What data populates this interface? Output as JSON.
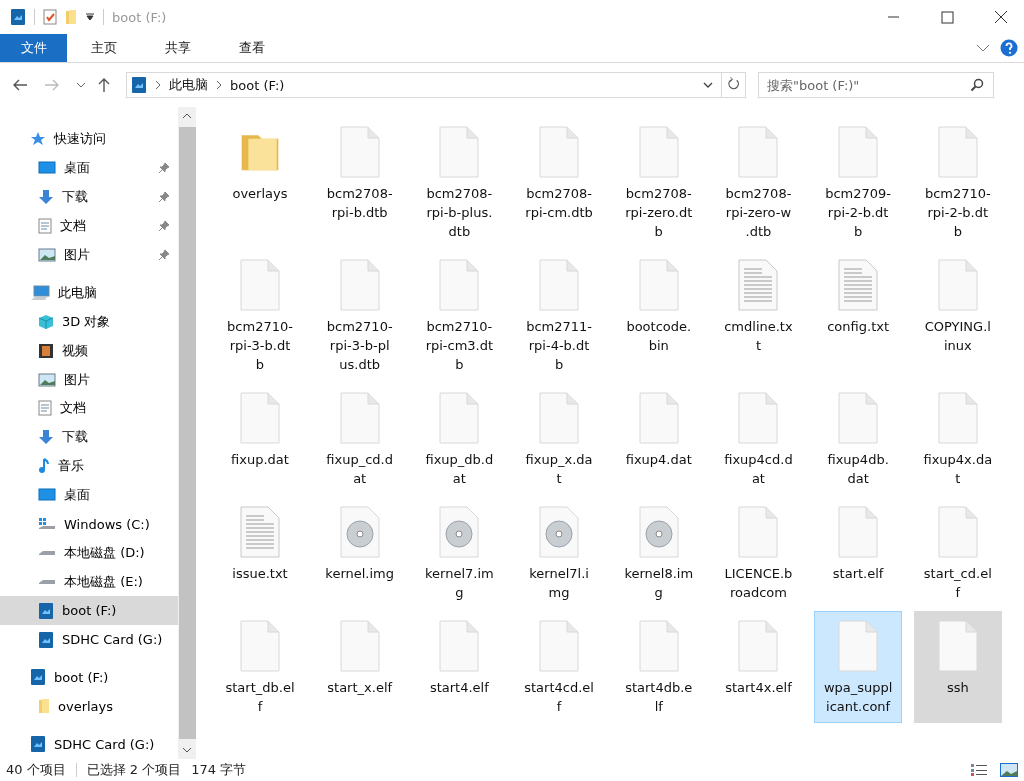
{
  "window": {
    "title": "boot (F:)"
  },
  "ribbon_tabs": [
    {
      "label": "文件",
      "selected": true
    },
    {
      "label": "主页",
      "selected": false
    },
    {
      "label": "共享",
      "selected": false
    },
    {
      "label": "查看",
      "selected": false
    }
  ],
  "address": {
    "crumbs": [
      "此电脑",
      "boot (F:)"
    ]
  },
  "search": {
    "placeholder": "搜索\"boot (F:)\""
  },
  "sidebar": {
    "items": [
      {
        "label": "快速访问",
        "kind": "star",
        "pinned": false,
        "selected": false,
        "children": [
          {
            "label": "桌面",
            "kind": "desktop",
            "pinned": true,
            "selected": false
          },
          {
            "label": "下载",
            "kind": "download",
            "pinned": true,
            "selected": false
          },
          {
            "label": "文档",
            "kind": "document",
            "pinned": true,
            "selected": false
          },
          {
            "label": "图片",
            "kind": "picture",
            "pinned": true,
            "selected": false
          }
        ]
      },
      {
        "label": "此电脑",
        "kind": "pc",
        "pinned": false,
        "selected": false,
        "children": [
          {
            "label": "3D 对象",
            "kind": "cube",
            "pinned": false,
            "selected": false
          },
          {
            "label": "视频",
            "kind": "video",
            "pinned": false,
            "selected": false
          },
          {
            "label": "图片",
            "kind": "picture",
            "pinned": false,
            "selected": false
          },
          {
            "label": "文档",
            "kind": "document",
            "pinned": false,
            "selected": false
          },
          {
            "label": "下载",
            "kind": "download",
            "pinned": false,
            "selected": false
          },
          {
            "label": "音乐",
            "kind": "music",
            "pinned": false,
            "selected": false
          },
          {
            "label": "桌面",
            "kind": "desktop",
            "pinned": false,
            "selected": false
          },
          {
            "label": "Windows (C:)",
            "kind": "windrive",
            "pinned": false,
            "selected": false
          },
          {
            "label": "本地磁盘 (D:)",
            "kind": "drive",
            "pinned": false,
            "selected": false
          },
          {
            "label": "本地磁盘 (E:)",
            "kind": "drive",
            "pinned": false,
            "selected": false
          },
          {
            "label": "boot (F:)",
            "kind": "sd",
            "pinned": false,
            "selected": true
          },
          {
            "label": "SDHC Card (G:)",
            "kind": "sd",
            "pinned": false,
            "selected": false
          }
        ]
      },
      {
        "label": "boot (F:)",
        "kind": "sd",
        "pinned": false,
        "selected": false,
        "children": [
          {
            "label": "overlays",
            "kind": "folder",
            "pinned": false,
            "selected": false
          }
        ]
      },
      {
        "label": "SDHC Card (G:)",
        "kind": "sd",
        "pinned": false,
        "selected": false
      }
    ]
  },
  "files": [
    {
      "lines": [
        "overlays"
      ],
      "kind": "folder",
      "selected": false,
      "hovered": false
    },
    {
      "lines": [
        "bcm2708-",
        "rpi-b.dtb"
      ],
      "kind": "blank",
      "selected": false,
      "hovered": false
    },
    {
      "lines": [
        "bcm2708-",
        "rpi-b-plus.",
        "dtb"
      ],
      "kind": "blank",
      "selected": false,
      "hovered": false
    },
    {
      "lines": [
        "bcm2708-",
        "rpi-cm.dtb"
      ],
      "kind": "blank",
      "selected": false,
      "hovered": false
    },
    {
      "lines": [
        "bcm2708-",
        "rpi-zero.dt",
        "b"
      ],
      "kind": "blank",
      "selected": false,
      "hovered": false
    },
    {
      "lines": [
        "bcm2708-",
        "rpi-zero-w",
        ".dtb"
      ],
      "kind": "blank",
      "selected": false,
      "hovered": false
    },
    {
      "lines": [
        "bcm2709-",
        "rpi-2-b.dt",
        "b"
      ],
      "kind": "blank",
      "selected": false,
      "hovered": false
    },
    {
      "lines": [
        "bcm2710-",
        "rpi-2-b.dt",
        "b"
      ],
      "kind": "blank",
      "selected": false,
      "hovered": false
    },
    {
      "lines": [
        "bcm2710-",
        "rpi-3-b.dt",
        "b"
      ],
      "kind": "blank",
      "selected": false,
      "hovered": false
    },
    {
      "lines": [
        "bcm2710-",
        "rpi-3-b-pl",
        "us.dtb"
      ],
      "kind": "blank",
      "selected": false,
      "hovered": false
    },
    {
      "lines": [
        "bcm2710-",
        "rpi-cm3.dt",
        "b"
      ],
      "kind": "blank",
      "selected": false,
      "hovered": false
    },
    {
      "lines": [
        "bcm2711-",
        "rpi-4-b.dt",
        "b"
      ],
      "kind": "blank",
      "selected": false,
      "hovered": false
    },
    {
      "lines": [
        "bootcode.",
        "bin"
      ],
      "kind": "blank",
      "selected": false,
      "hovered": false
    },
    {
      "lines": [
        "cmdline.tx",
        "t"
      ],
      "kind": "text",
      "selected": false,
      "hovered": false
    },
    {
      "lines": [
        "config.txt"
      ],
      "kind": "text",
      "selected": false,
      "hovered": false
    },
    {
      "lines": [
        "COPYING.l",
        "inux"
      ],
      "kind": "blank",
      "selected": false,
      "hovered": false
    },
    {
      "lines": [
        "fixup.dat"
      ],
      "kind": "blank",
      "selected": false,
      "hovered": false
    },
    {
      "lines": [
        "fixup_cd.d",
        "at"
      ],
      "kind": "blank",
      "selected": false,
      "hovered": false
    },
    {
      "lines": [
        "fixup_db.d",
        "at"
      ],
      "kind": "blank",
      "selected": false,
      "hovered": false
    },
    {
      "lines": [
        "fixup_x.da",
        "t"
      ],
      "kind": "blank",
      "selected": false,
      "hovered": false
    },
    {
      "lines": [
        "fixup4.dat"
      ],
      "kind": "blank",
      "selected": false,
      "hovered": false
    },
    {
      "lines": [
        "fixup4cd.d",
        "at"
      ],
      "kind": "blank",
      "selected": false,
      "hovered": false
    },
    {
      "lines": [
        "fixup4db.",
        "dat"
      ],
      "kind": "blank",
      "selected": false,
      "hovered": false
    },
    {
      "lines": [
        "fixup4x.da",
        "t"
      ],
      "kind": "blank",
      "selected": false,
      "hovered": false
    },
    {
      "lines": [
        "issue.txt"
      ],
      "kind": "text",
      "selected": false,
      "hovered": false
    },
    {
      "lines": [
        "kernel.img"
      ],
      "kind": "disc",
      "selected": false,
      "hovered": false
    },
    {
      "lines": [
        "kernel7.im",
        "g"
      ],
      "kind": "disc",
      "selected": false,
      "hovered": false
    },
    {
      "lines": [
        "kernel7l.i",
        "mg"
      ],
      "kind": "disc",
      "selected": false,
      "hovered": false
    },
    {
      "lines": [
        "kernel8.im",
        "g"
      ],
      "kind": "disc",
      "selected": false,
      "hovered": false
    },
    {
      "lines": [
        "LICENCE.b",
        "roadcom"
      ],
      "kind": "blank",
      "selected": false,
      "hovered": false
    },
    {
      "lines": [
        "start.elf"
      ],
      "kind": "blank",
      "selected": false,
      "hovered": false
    },
    {
      "lines": [
        "start_cd.el",
        "f"
      ],
      "kind": "blank",
      "selected": false,
      "hovered": false
    },
    {
      "lines": [
        "start_db.el",
        "f"
      ],
      "kind": "blank",
      "selected": false,
      "hovered": false
    },
    {
      "lines": [
        "start_x.elf"
      ],
      "kind": "blank",
      "selected": false,
      "hovered": false
    },
    {
      "lines": [
        "start4.elf"
      ],
      "kind": "blank",
      "selected": false,
      "hovered": false
    },
    {
      "lines": [
        "start4cd.el",
        "f"
      ],
      "kind": "blank",
      "selected": false,
      "hovered": false
    },
    {
      "lines": [
        "start4db.e",
        "lf"
      ],
      "kind": "blank",
      "selected": false,
      "hovered": false
    },
    {
      "lines": [
        "start4x.elf"
      ],
      "kind": "blank",
      "selected": false,
      "hovered": false
    },
    {
      "lines": [
        "wpa_suppl",
        "icant.conf"
      ],
      "kind": "blank",
      "selected": true,
      "hovered": true
    },
    {
      "lines": [
        "ssh"
      ],
      "kind": "blank",
      "selected": true,
      "hovered": false
    }
  ],
  "status_bar": {
    "count": "40 个项目",
    "selection": "已选择 2 个项目",
    "size": "174 字节"
  }
}
